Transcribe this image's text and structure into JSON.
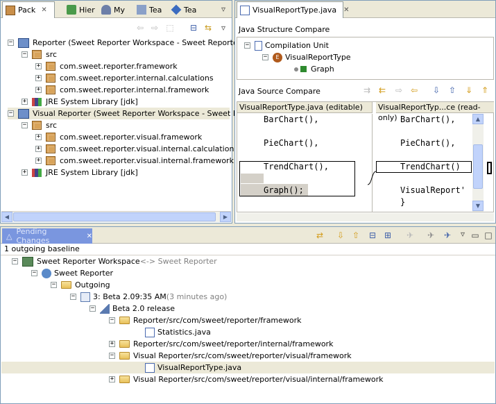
{
  "left_tabs": [
    {
      "label": "Pack",
      "close": "✕"
    },
    {
      "label": "Hier"
    },
    {
      "label": "My"
    },
    {
      "label": "Tea"
    },
    {
      "label": "Tea"
    }
  ],
  "package_tree": [
    {
      "label": "Reporter (Sweet Reporter Workspace - Sweet Reporter)",
      "kind": "project",
      "expander": "⊟"
    },
    {
      "label": "src",
      "kind": "srcfolder",
      "expander": "⊟"
    },
    {
      "label": "com.sweet.reporter.framework",
      "kind": "package",
      "expander": "⊞"
    },
    {
      "label": "com.sweet.reporter.internal.calculations",
      "kind": "package",
      "expander": "⊞"
    },
    {
      "label": "com.sweet.reporter.internal.framework",
      "kind": "package",
      "expander": "⊞"
    },
    {
      "label": "JRE System Library [jdk]",
      "kind": "library",
      "expander": "⊞"
    },
    {
      "label": "Visual Reporter (Sweet Reporter Workspace - Sweet Reporter)",
      "kind": "project",
      "expander": "⊟"
    },
    {
      "label": "src",
      "kind": "srcfolder",
      "expander": "⊟"
    },
    {
      "label": "com.sweet.reporter.visual.framework",
      "kind": "package",
      "expander": "⊞"
    },
    {
      "label": "com.sweet.reporter.visual.internal.calculations",
      "kind": "package",
      "expander": "⊞"
    },
    {
      "label": "com.sweet.reporter.visual.internal.framework",
      "kind": "package",
      "expander": "⊞"
    },
    {
      "label": "JRE System Library [jdk]",
      "kind": "library",
      "expander": "⊞"
    }
  ],
  "editor": {
    "tab_label": "VisualReportType.java",
    "close": "✕",
    "structure_title": "Java Structure Compare",
    "structure_tree": [
      "Compilation Unit",
      "VisualReportType",
      "Graph"
    ],
    "source_title": "Java Source Compare",
    "left_header": "VisualReportType.java (editable)",
    "right_header": "VisualReportTyp...ce (read-only)",
    "left_lines": [
      "BarChart(),",
      "",
      "PieChart(),",
      "",
      "TrendChart(),",
      "",
      "Graph();"
    ],
    "right_lines": [
      "BarChart(),",
      "",
      "PieChart(),",
      "",
      "TrendChart()",
      "",
      "VisualReport'",
      "}"
    ]
  },
  "pending": {
    "title": "Pending Changes",
    "close": "✕",
    "status": "1 outgoing baseline",
    "rows": [
      {
        "label": "Sweet Reporter Workspace",
        "suffix": " <-> Sweet Reporter",
        "expander": "⊟"
      },
      {
        "label": "Sweet Reporter",
        "expander": "⊟"
      },
      {
        "label": "Outgoing",
        "expander": "⊟"
      },
      {
        "label": "3: Beta 2.0",
        "suffix": "  9:35 AM",
        "suffix2": " (3 minutes ago)",
        "expander": "⊟"
      },
      {
        "label": "Beta 2.0 release",
        "expander": "⊟"
      },
      {
        "label": "Reporter/src/com/sweet/reporter/framework",
        "expander": "⊟"
      },
      {
        "label": "Statistics.java",
        "expander": ""
      },
      {
        "label": "Reporter/src/com/sweet/reporter/internal/framework",
        "expander": "⊞"
      },
      {
        "label": "Visual Reporter/src/com/sweet/reporter/visual/framework",
        "expander": "⊟"
      },
      {
        "label": "VisualReportType.java",
        "expander": ""
      },
      {
        "label": "Visual Reporter/src/com/sweet/reporter/visual/internal/framework",
        "expander": "⊞"
      }
    ]
  }
}
